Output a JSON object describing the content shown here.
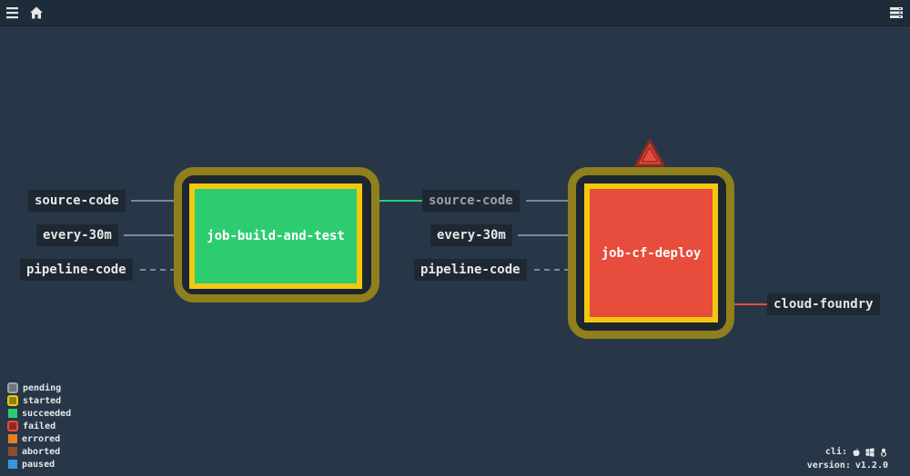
{
  "topbar": {
    "menu_icon": "hamburger-menu-icon",
    "home_icon": "home-icon",
    "pipelines_icon": "server-list-icon"
  },
  "graph": {
    "jobs": [
      {
        "name": "job-build-and-test",
        "status": "succeeded",
        "running": true
      },
      {
        "name": "job-cf-deploy",
        "status": "failed",
        "running": true
      }
    ],
    "inputs_job1": [
      "source-code",
      "every-30m",
      "pipeline-code"
    ],
    "inputs_job2": [
      "source-code",
      "every-30m",
      "pipeline-code"
    ],
    "outputs_job2": [
      "cloud-foundry"
    ],
    "warning_icon": "warning-triangle-icon"
  },
  "legend": {
    "items": [
      {
        "label": "pending",
        "color": "#9aa5ae",
        "style": "ring"
      },
      {
        "label": "started",
        "color": "#f2c80e",
        "style": "ring"
      },
      {
        "label": "succeeded",
        "color": "#2ecc71",
        "style": "fill"
      },
      {
        "label": "failed",
        "color": "#e74c3c",
        "style": "ring"
      },
      {
        "label": "errored",
        "color": "#e67e22",
        "style": "fill"
      },
      {
        "label": "aborted",
        "color": "#8f4b2d",
        "style": "fill"
      },
      {
        "label": "paused",
        "color": "#3498db",
        "style": "fill"
      }
    ]
  },
  "footer": {
    "cli_label": "cli:",
    "version_label": "version:",
    "version_value": "v1.2.0",
    "cli_icons": [
      "apple-icon",
      "windows-icon",
      "linux-icon"
    ]
  },
  "colors": {
    "background": "#273747",
    "succeeded": "#2ecc71",
    "failed": "#e74c3c",
    "started": "#f2c80e"
  }
}
